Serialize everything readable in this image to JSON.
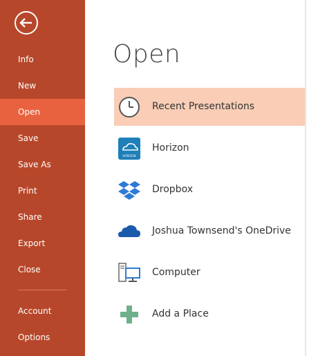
{
  "sidebar": {
    "back_icon": "back-arrow-icon",
    "items": [
      {
        "label": "Info"
      },
      {
        "label": "New"
      },
      {
        "label": "Open"
      },
      {
        "label": "Save"
      },
      {
        "label": "Save As"
      },
      {
        "label": "Print"
      },
      {
        "label": "Share"
      },
      {
        "label": "Export"
      },
      {
        "label": "Close"
      },
      {
        "label": "Account"
      },
      {
        "label": "Options"
      }
    ],
    "active_item": "Open"
  },
  "main": {
    "title": "Open",
    "places": [
      {
        "label": "Recent Presentations",
        "icon": "clock-icon",
        "selected": true
      },
      {
        "label": "Horizon",
        "icon": "horizon-cloud-icon",
        "icon_caption": "HORIZON"
      },
      {
        "label": "Dropbox",
        "icon": "dropbox-icon"
      },
      {
        "label": "Joshua Townsend's OneDrive",
        "icon": "onedrive-icon"
      },
      {
        "label": "Computer",
        "icon": "computer-icon"
      },
      {
        "label": "Add a Place",
        "icon": "add-place-icon"
      }
    ]
  },
  "colors": {
    "sidebar_bg": "#b7472a",
    "sidebar_active": "#e9623f",
    "selected_row": "#f9cdb6",
    "dropbox_blue": "#2e7bd4",
    "onedrive_blue": "#1a5aaa",
    "add_place_green": "#6fb08a"
  }
}
